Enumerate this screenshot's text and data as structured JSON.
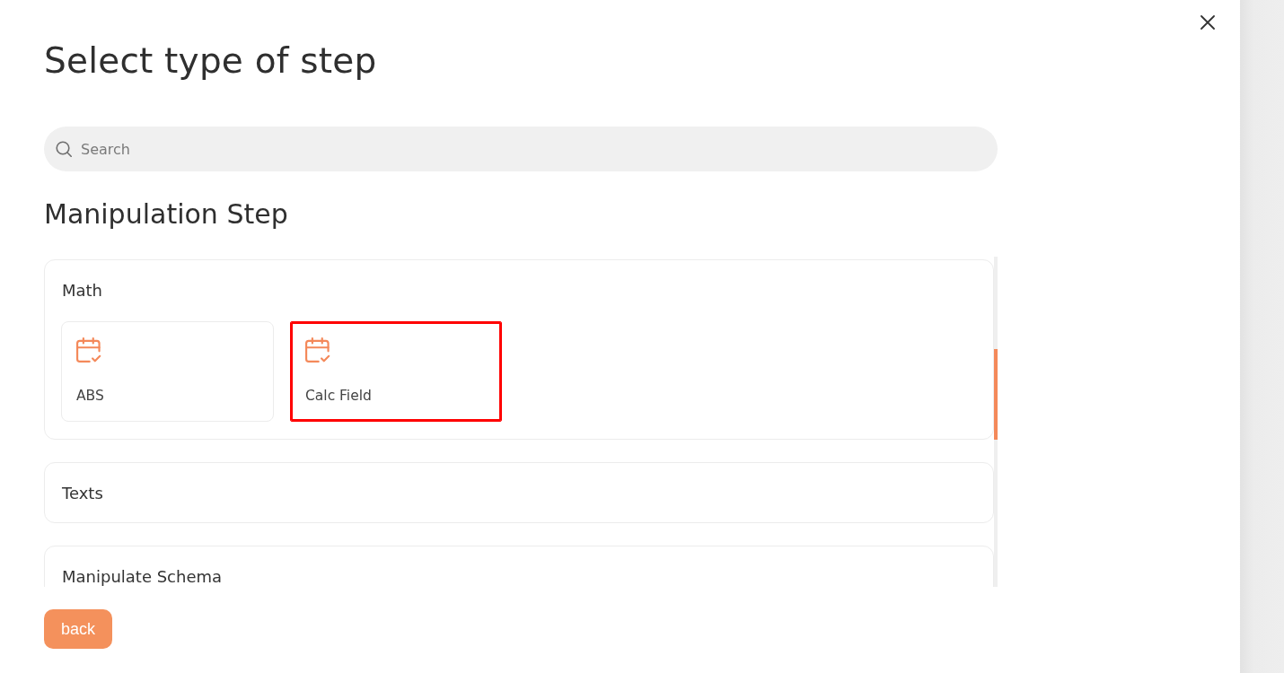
{
  "dialog": {
    "title": "Select type of step"
  },
  "search": {
    "placeholder": "Search"
  },
  "section": {
    "heading": "Manipulation Step",
    "groups": [
      {
        "name": "Math",
        "steps": [
          {
            "label": "ABS",
            "selected": false
          },
          {
            "label": "Calc Field",
            "selected": true
          }
        ]
      },
      {
        "name": "Texts"
      },
      {
        "name": "Manipulate Schema"
      }
    ]
  },
  "buttons": [
    {
      "label": "back"
    }
  ]
}
